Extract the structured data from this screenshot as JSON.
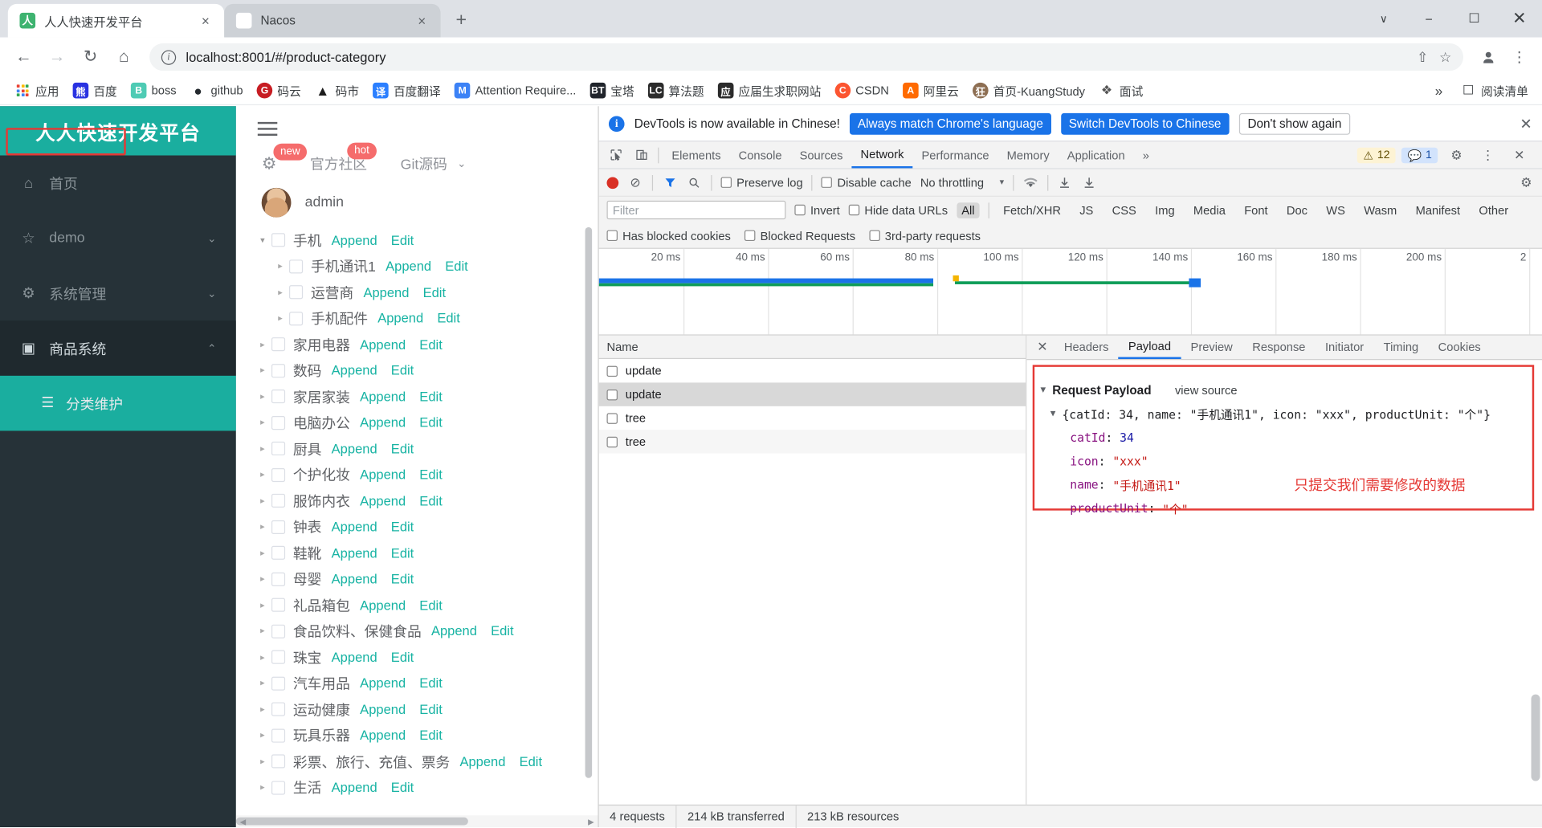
{
  "browser": {
    "tabs": [
      {
        "title": "人人快速开发平台",
        "favicon": "ren-icon",
        "active": true,
        "close_label": "×"
      },
      {
        "title": "Nacos",
        "favicon": "nacos-icon",
        "active": false,
        "close_label": "×"
      }
    ],
    "new_tab_label": "+",
    "window_controls": {
      "list": "∨",
      "minimize": "−",
      "maximize": "☐",
      "close": "✕"
    },
    "nav": {
      "back": "←",
      "forward": "→",
      "reload": "↻",
      "home": "⌂"
    },
    "omnibox": {
      "url": "localhost:8001/#/product-category",
      "info_icon": "i",
      "share_icon": "⇧",
      "star_icon": "☆",
      "profile_icon": "●",
      "menu_icon": "⋮"
    },
    "bookmarks": [
      {
        "label": "应用",
        "icon": "apps-grid-icon",
        "color": "#4285f4"
      },
      {
        "label": "百度",
        "icon": "baidu-icon",
        "color": "#2932e1"
      },
      {
        "label": "boss",
        "icon": "boss-icon",
        "color": "#4ecbb4"
      },
      {
        "label": "github",
        "icon": "github-icon",
        "color": "#24292e"
      },
      {
        "label": "码云",
        "icon": "gitee-icon",
        "color": "#c71d23"
      },
      {
        "label": "码市",
        "icon": "mashi-icon",
        "color": "#1c1c1c"
      },
      {
        "label": "百度翻译",
        "icon": "fanyi-icon",
        "color": "#2b7fff"
      },
      {
        "label": "Attention Require...",
        "icon": "cloudflare-icon",
        "color": "#3c82f6"
      },
      {
        "label": "宝塔",
        "icon": "bt-icon",
        "color": "#20242b"
      },
      {
        "label": "算法题",
        "icon": "suanfa-icon",
        "color": "#2b2b2b"
      },
      {
        "label": "应届生求职网站",
        "icon": "yjs-icon",
        "color": "#2b2b2b"
      },
      {
        "label": "CSDN",
        "icon": "csdn-icon",
        "color": "#fc5531"
      },
      {
        "label": "阿里云",
        "icon": "aliyun-icon",
        "color": "#ff6a00"
      },
      {
        "label": "首页-KuangStudy",
        "icon": "kuang-icon",
        "color": "#8d6e52"
      },
      {
        "label": "面试",
        "icon": "mianshi-icon",
        "color": "#555555"
      }
    ],
    "bookmarks_overflow": "»",
    "reading_list": {
      "label": "阅读清单",
      "icon": "reading-list-icon"
    }
  },
  "app": {
    "brand": "人人快速开发平台",
    "menu": [
      {
        "label": "首页",
        "icon": "home-icon",
        "chevron": "",
        "active": false
      },
      {
        "label": "demo",
        "icon": "star-icon",
        "chevron": "⌄",
        "active": false
      },
      {
        "label": "系统管理",
        "icon": "gear-icon",
        "chevron": "⌄",
        "active": false
      },
      {
        "label": "商品系统",
        "icon": "box-icon",
        "chevron": "⌃",
        "active": true
      }
    ],
    "submenu": [
      {
        "label": "分类维护",
        "icon": "list-icon",
        "active": true
      }
    ],
    "hamburger": "menu-icon",
    "topwidgets": [
      {
        "label": "",
        "icon": "gear-icon",
        "badge": "new"
      },
      {
        "label": "官方社区",
        "icon": "",
        "badge": "hot"
      },
      {
        "label": "Git源码",
        "icon": "",
        "badge": "",
        "chevron": "⌄"
      }
    ],
    "user": {
      "name": "admin",
      "avatar": "user-avatar"
    },
    "tree_actions": {
      "append": "Append",
      "edit": "Edit"
    },
    "tree": [
      {
        "label": "手机",
        "depth": 0,
        "expanded": true,
        "arrow": "▾"
      },
      {
        "label": "手机通讯1",
        "depth": 1,
        "expanded": false,
        "arrow": "▸"
      },
      {
        "label": "运营商",
        "depth": 1,
        "expanded": false,
        "arrow": "▸"
      },
      {
        "label": "手机配件",
        "depth": 1,
        "expanded": false,
        "arrow": "▸"
      },
      {
        "label": "家用电器",
        "depth": 0,
        "expanded": false,
        "arrow": "▸"
      },
      {
        "label": "数码",
        "depth": 0,
        "expanded": false,
        "arrow": "▸"
      },
      {
        "label": "家居家装",
        "depth": 0,
        "expanded": false,
        "arrow": "▸"
      },
      {
        "label": "电脑办公",
        "depth": 0,
        "expanded": false,
        "arrow": "▸"
      },
      {
        "label": "厨具",
        "depth": 0,
        "expanded": false,
        "arrow": "▸"
      },
      {
        "label": "个护化妆",
        "depth": 0,
        "expanded": false,
        "arrow": "▸"
      },
      {
        "label": "服饰内衣",
        "depth": 0,
        "expanded": false,
        "arrow": "▸"
      },
      {
        "label": "钟表",
        "depth": 0,
        "expanded": false,
        "arrow": "▸"
      },
      {
        "label": "鞋靴",
        "depth": 0,
        "expanded": false,
        "arrow": "▸"
      },
      {
        "label": "母婴",
        "depth": 0,
        "expanded": false,
        "arrow": "▸"
      },
      {
        "label": "礼品箱包",
        "depth": 0,
        "expanded": false,
        "arrow": "▸"
      },
      {
        "label": "食品饮料、保健食品",
        "depth": 0,
        "expanded": false,
        "arrow": "▸"
      },
      {
        "label": "珠宝",
        "depth": 0,
        "expanded": false,
        "arrow": "▸"
      },
      {
        "label": "汽车用品",
        "depth": 0,
        "expanded": false,
        "arrow": "▸"
      },
      {
        "label": "运动健康",
        "depth": 0,
        "expanded": false,
        "arrow": "▸"
      },
      {
        "label": "玩具乐器",
        "depth": 0,
        "expanded": false,
        "arrow": "▸"
      },
      {
        "label": "彩票、旅行、充值、票务",
        "depth": 0,
        "expanded": false,
        "arrow": "▸"
      },
      {
        "label": "生活",
        "depth": 0,
        "expanded": false,
        "arrow": "▸"
      }
    ]
  },
  "devtools": {
    "banner": {
      "message": "DevTools is now available in Chinese!",
      "primary_button": "Always match Chrome's language",
      "secondary_button": "Switch DevTools to Chinese",
      "tertiary_button": "Don't show again",
      "close": "✕"
    },
    "panel_tabs": [
      {
        "label": "Elements",
        "selected": false
      },
      {
        "label": "Console",
        "selected": false
      },
      {
        "label": "Sources",
        "selected": false
      },
      {
        "label": "Network",
        "selected": true
      },
      {
        "label": "Performance",
        "selected": false
      },
      {
        "label": "Memory",
        "selected": false
      },
      {
        "label": "Application",
        "selected": false
      }
    ],
    "panel_overflow": "»",
    "warnings_count": "12",
    "messages_count": "1",
    "settings_icon": "gear-icon",
    "more_icon": "kebab-icon",
    "close_icon": "close-icon",
    "toolbar": {
      "record_label": "record-button",
      "clear_label": "clear-button",
      "filter_icon": "filter-icon",
      "search_icon": "search-icon",
      "preserve_log": "Preserve log",
      "disable_cache": "Disable cache",
      "throttling": "No throttling",
      "throttling_caret": "▾",
      "wifi_icon": "network-conditions-icon",
      "import_icon": "import-har-icon",
      "export_icon": "export-har-icon"
    },
    "filter_row": {
      "placeholder": "Filter",
      "invert": "Invert",
      "hide_data_urls": "Hide data URLs",
      "types": [
        "All",
        "Fetch/XHR",
        "JS",
        "CSS",
        "Img",
        "Media",
        "Font",
        "Doc",
        "WS",
        "Wasm",
        "Manifest",
        "Other"
      ],
      "selected_type": "All"
    },
    "filter_row2": {
      "has_blocked_cookies": "Has blocked cookies",
      "blocked_requests": "Blocked Requests",
      "third_party": "3rd-party requests"
    },
    "timeline_ticks": [
      "20 ms",
      "40 ms",
      "60 ms",
      "80 ms",
      "100 ms",
      "120 ms",
      "140 ms",
      "160 ms",
      "180 ms",
      "200 ms",
      "2"
    ],
    "requests_header": "Name",
    "requests": [
      {
        "name": "update",
        "selected": false
      },
      {
        "name": "update",
        "selected": true
      },
      {
        "name": "tree",
        "selected": false
      },
      {
        "name": "tree",
        "selected": false
      }
    ],
    "detail_tabs": [
      {
        "label": "Headers",
        "selected": false
      },
      {
        "label": "Payload",
        "selected": true
      },
      {
        "label": "Preview",
        "selected": false
      },
      {
        "label": "Response",
        "selected": false
      },
      {
        "label": "Initiator",
        "selected": false
      },
      {
        "label": "Timing",
        "selected": false
      },
      {
        "label": "Cookies",
        "selected": false
      }
    ],
    "payload": {
      "section_title": "Request Payload",
      "view_source": "view source",
      "summary_prefix": "{catId: ",
      "summary": "{catId: 34, name: \"手机通讯1\", icon: \"xxx\", productUnit: \"个\"}",
      "fields": [
        {
          "key": "catId",
          "value": "34",
          "type": "number"
        },
        {
          "key": "icon",
          "value": "\"xxx\"",
          "type": "string"
        },
        {
          "key": "name",
          "value": "\"手机通讯1\"",
          "type": "string"
        },
        {
          "key": "productUnit",
          "value": "\"个\"",
          "type": "string"
        }
      ],
      "annotation": "只提交我们需要修改的数据"
    },
    "status": {
      "requests": "4 requests",
      "transferred": "214 kB transferred",
      "resources": "213 kB resources"
    }
  }
}
